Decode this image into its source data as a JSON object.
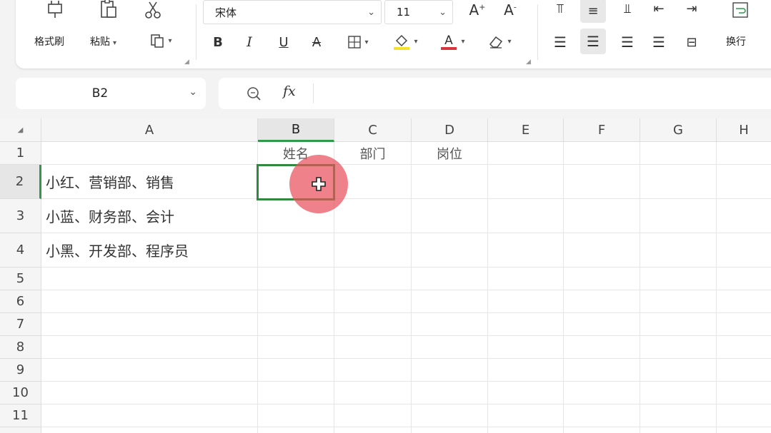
{
  "ribbon": {
    "format_painter_label": "格式刷",
    "paste_label": "粘贴",
    "font_name": "宋体",
    "font_size": "11",
    "wrap_label": "换行"
  },
  "formula_bar": {
    "cell_ref": "B2",
    "fx_label": "fx",
    "content": ""
  },
  "sheet": {
    "corner": "◢",
    "columns": [
      "A",
      "B",
      "C",
      "D",
      "E",
      "F",
      "G",
      "H"
    ],
    "rows": [
      "1",
      "2",
      "3",
      "4",
      "5",
      "6",
      "7",
      "8",
      "9",
      "10",
      "11"
    ],
    "cells": {
      "B1": "姓名",
      "C1": "部门",
      "D1": "岗位",
      "A2": "小红、营销部、销售",
      "A3": "小蓝、财务部、会计",
      "A4": "小黑、开发部、程序员"
    },
    "active_cell": "B2",
    "accent_color": "#2f9a4a",
    "cursor_color": "#e8505c"
  }
}
